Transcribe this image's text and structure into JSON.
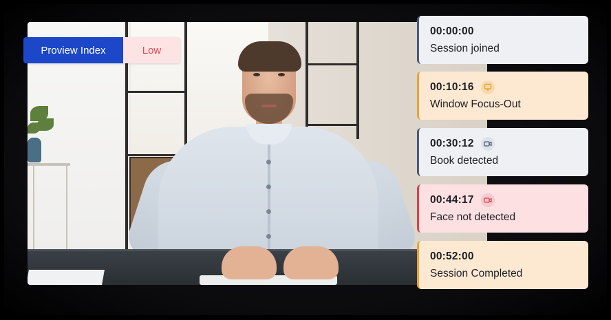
{
  "index_badge": {
    "label": "Proview Index",
    "value": "Low",
    "label_bg": "#1b47c8",
    "value_bg": "#fde3e4",
    "value_color": "#e04b55"
  },
  "events": [
    {
      "time": "00:00:00",
      "label": "Session joined",
      "severity": "neutral",
      "icon": null
    },
    {
      "time": "00:10:16",
      "label": "Window Focus-Out",
      "severity": "warning",
      "icon": "monitor-icon"
    },
    {
      "time": "00:30:12",
      "label": "Book detected",
      "severity": "neutral",
      "icon": "video-camera-icon"
    },
    {
      "time": "00:44:17",
      "label": "Face not detected",
      "severity": "alert",
      "icon": "video-camera-icon"
    },
    {
      "time": "00:52:00",
      "label": "Session Completed",
      "severity": "warning",
      "icon": null
    }
  ],
  "colors": {
    "neutral_accent": "#4a5a78",
    "warning_accent": "#e8a43a",
    "alert_accent": "#d9414c"
  }
}
